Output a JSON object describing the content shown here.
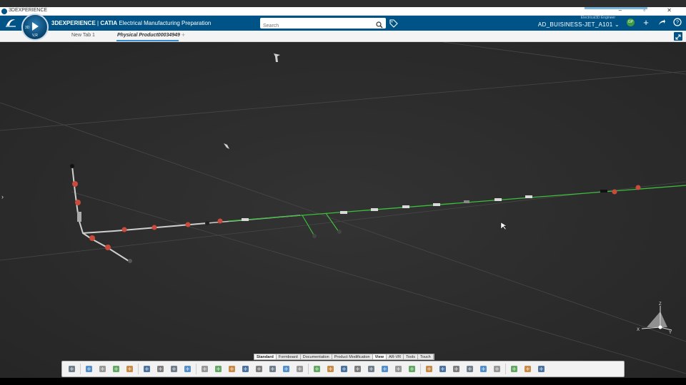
{
  "os_window": {
    "title": "3DEXPERIENCE",
    "controls": "– ▫ ✕"
  },
  "header": {
    "brand": "3DEXPERIENCE",
    "separator": " | ",
    "product": "CATIA",
    "app_name": "Electrical Manufacturing Preparation",
    "compass_label": "V,R",
    "compass_left": "3D",
    "compass_right": "",
    "search_placeholder": "Search",
    "role": "Electrical3D Engineer",
    "collab_space": "AD_BUISINESS-JET_A101",
    "avatar_initials": "GP",
    "colors": {
      "header_bg": "#005386",
      "accent": "#3a8fd0"
    }
  },
  "tabs": [
    {
      "label": "New Tab 1",
      "active": false
    },
    {
      "label": "Physical Product00034949",
      "active": true
    }
  ],
  "toolbar_tabs": [
    {
      "label": "Standard",
      "selected": true
    },
    {
      "label": "Formboard",
      "selected": false
    },
    {
      "label": "Documentation",
      "selected": false
    },
    {
      "label": "Product Modification",
      "selected": false
    },
    {
      "label": "View",
      "selected": true
    },
    {
      "label": "AR-VR",
      "selected": false
    },
    {
      "label": "Tools",
      "selected": false
    },
    {
      "label": "Touch",
      "selected": false
    }
  ],
  "toolbar_icons": [
    "collapse-icon",
    "cut-icon",
    "copy-icon",
    "paste-icon",
    "undo-icon",
    "zoom-select-icon",
    "branch-icon",
    "route-icon",
    "segment-icon",
    "cloud-icon",
    "hand-icon",
    "pin-icon",
    "flatten-icon",
    "bundle-icon",
    "dimension-icon",
    "bar-chart-icon",
    "layout-icon",
    "search-zoom-icon",
    "cube-view-icon",
    "fit-all-icon",
    "pan-icon",
    "rotate-icon",
    "zoom-icon",
    "normal-view-icon",
    "iso-view-icon",
    "settings-icon",
    "render-icon",
    "capture-icon",
    "hide-show-icon",
    "swap-icon",
    "measure-icon",
    "view-mode-icon",
    "tree-icon",
    "options-icon"
  ],
  "compass": {
    "x_label": "X",
    "y_label": "Y",
    "z_label": "Z"
  }
}
